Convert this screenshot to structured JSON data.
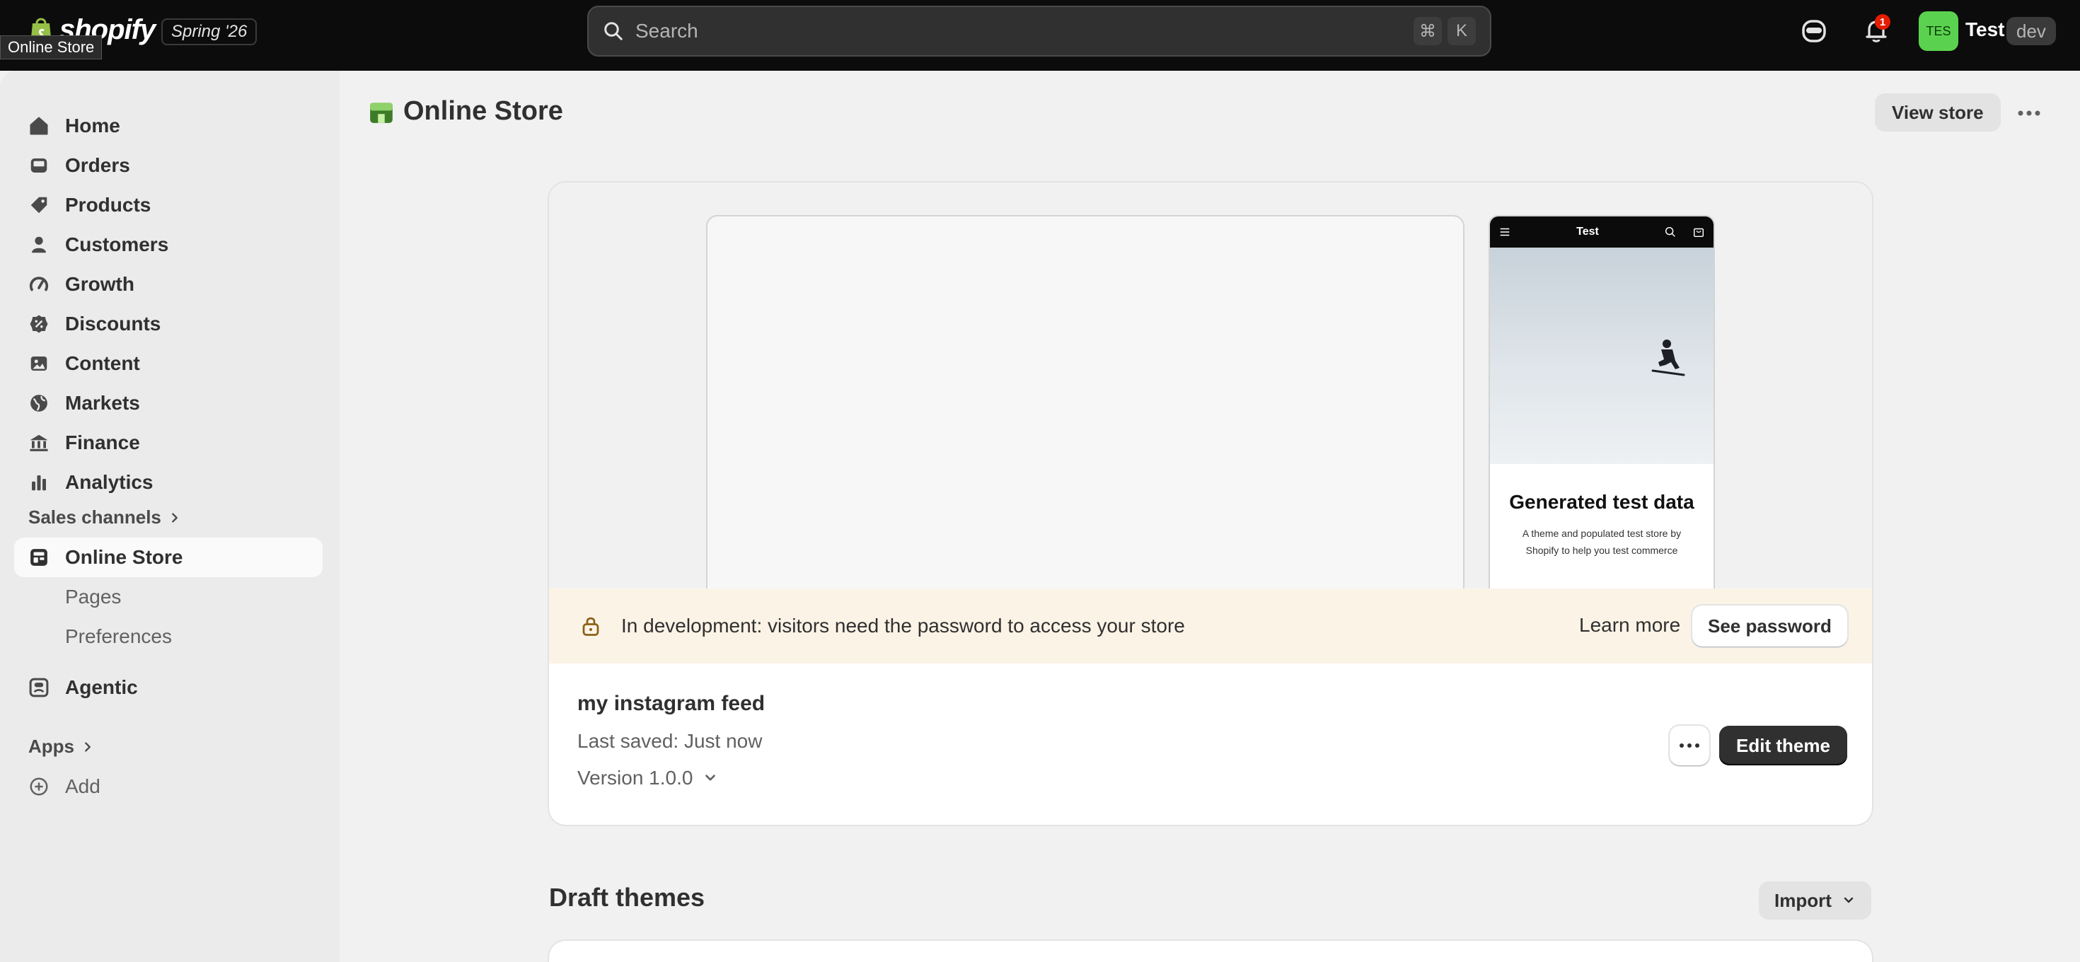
{
  "topbar": {
    "brand": "shopify",
    "edition": "Spring '26",
    "tooltip": "Online Store",
    "search": {
      "placeholder": "Search",
      "shortcut_mod": "⌘",
      "shortcut_key": "K"
    },
    "notification_count": "1",
    "avatar_initials": "TES",
    "user_name": "Test",
    "env_badge": "dev"
  },
  "sidebar": {
    "items": [
      {
        "label": "Home",
        "icon": "home-icon"
      },
      {
        "label": "Orders",
        "icon": "inbox-icon"
      },
      {
        "label": "Products",
        "icon": "tag-icon"
      },
      {
        "label": "Customers",
        "icon": "person-icon"
      },
      {
        "label": "Growth",
        "icon": "gauge-icon"
      },
      {
        "label": "Discounts",
        "icon": "discount-icon"
      },
      {
        "label": "Content",
        "icon": "image-icon"
      },
      {
        "label": "Markets",
        "icon": "globe-icon"
      },
      {
        "label": "Finance",
        "icon": "bank-icon"
      },
      {
        "label": "Analytics",
        "icon": "bar-chart-icon"
      }
    ],
    "sales_channels_label": "Sales channels",
    "online_store_label": "Online Store",
    "sub_items": [
      "Pages",
      "Preferences"
    ],
    "agentic_label": "Agentic",
    "apps_label": "Apps",
    "add_label": "Add"
  },
  "main": {
    "title": "Online Store",
    "view_store_label": "View store",
    "preview": {
      "mobile_store_name": "Test",
      "mobile_heading": "Generated test data",
      "mobile_subtext": "A theme and populated test store by Shopify to help you test commerce"
    },
    "banner": {
      "message": "In development: visitors need the password to access your store",
      "learn_more": "Learn more",
      "see_password": "See password"
    },
    "theme": {
      "name": "my instagram feed",
      "saved": "Last saved: Just now",
      "version": "Version 1.0.0",
      "edit_label": "Edit theme"
    },
    "draft_themes_title": "Draft themes",
    "import_label": "Import"
  },
  "colors": {
    "topbar_bg": "#0c0c0c",
    "avatar_bg": "#5bd24f",
    "banner_bg": "#fbf3e6",
    "primary_button": "#303030",
    "notification_badge": "#e51c00"
  }
}
